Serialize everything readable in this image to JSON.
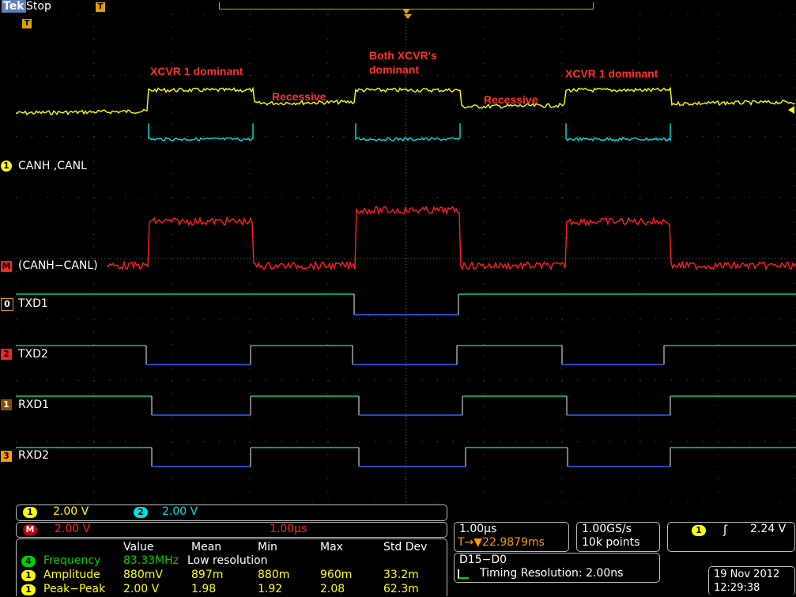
{
  "header": {
    "brand": "Tek",
    "run_state": "Stop",
    "trigger_marker": "T",
    "trigger_marker_screen": "T"
  },
  "annotations": {
    "a1": "XCVR 1 dominant",
    "a2": "Recessive",
    "a3_line1": "Both XCVR's",
    "a3_line2": "dominant",
    "a4": "Recessive",
    "a5": "XCVR 1 dominant"
  },
  "channels": {
    "ch1": {
      "badge": "1",
      "label": "CANH ,CANL"
    },
    "math": {
      "badge": "M",
      "label": "(CANH−CANL)"
    },
    "d0": {
      "badge": "0",
      "label": "TXD1"
    },
    "d2": {
      "badge": "2",
      "label": "TXD2"
    },
    "d1": {
      "badge": "1",
      "label": "RXD1"
    },
    "d3": {
      "badge": "3",
      "label": "RXD2"
    }
  },
  "scale": {
    "ch1_badge": "1",
    "ch1_scale": "2.00 V",
    "ch2_badge": "2",
    "ch2_scale": "2.00 V",
    "math_badge": "M",
    "math_scale": "2.00 V",
    "math_time": "1.00µs"
  },
  "horizontal": {
    "timebase": "1.00µs",
    "trigger_pos": "T→▼22.9879ms",
    "sample_rate": "1.00GS/s",
    "record_length": "10k points"
  },
  "trigger": {
    "badge": "1",
    "slope": "ʃ",
    "level": "2.24 V"
  },
  "digital": {
    "title": "D15−D0",
    "timing": "Timing Resolution: 2.00ns"
  },
  "datetime": {
    "date": "19 Nov 2012",
    "time": "12:29:38"
  },
  "measurements": {
    "headers": [
      "Value",
      "Mean",
      "Min",
      "Max",
      "Std Dev"
    ],
    "rows": [
      {
        "badge": "4",
        "name": "Frequency",
        "value": "83.33MHz",
        "note": "Low resolution",
        "mean": "",
        "min": "",
        "max": "",
        "std": ""
      },
      {
        "badge": "1",
        "name": "Amplitude",
        "value": "880mV",
        "note": "",
        "mean": "897m",
        "min": "880m",
        "max": "960m",
        "std": "33.2m"
      },
      {
        "badge": "1",
        "name": "Peak−Peak",
        "value": "2.00 V",
        "note": "",
        "mean": "1.98",
        "min": "1.92",
        "max": "2.08",
        "std": "62.3m"
      }
    ]
  },
  "colors": {
    "ch1": "#ffff00",
    "ch2": "#00e0e0",
    "math": "#ff2020",
    "digital_high": "#00d080",
    "digital_low": "#3060ff",
    "marker": "#e0a000",
    "annotation": "#ff3030"
  }
}
